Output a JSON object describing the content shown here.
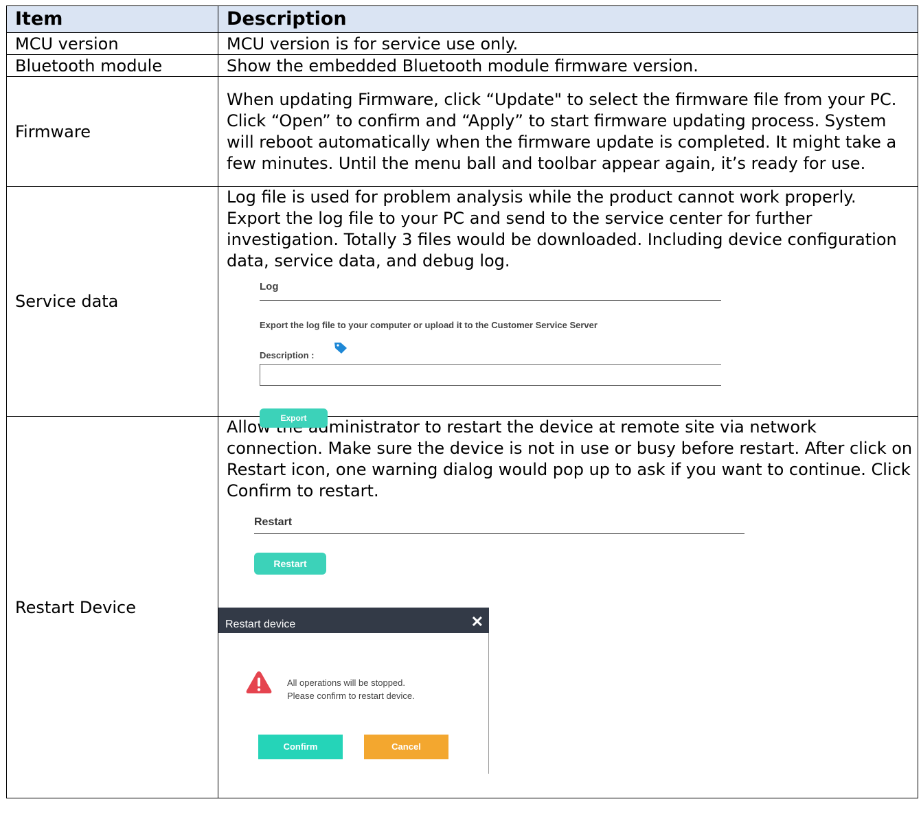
{
  "table": {
    "headers": {
      "item": "Item",
      "description": "Description"
    },
    "rows": [
      {
        "item": "MCU version",
        "description": "MCU version is for service use only."
      },
      {
        "item": "Bluetooth module",
        "description": "Show the embedded Bluetooth module firmware version."
      },
      {
        "item": "Firmware",
        "description": "When updating Firmware, click “Update\" to select the firmware file from your PC. Click “Open” to confirm and “Apply” to start firmware updating process. System will reboot automatically when the firmware update is completed. It might take a few minutes. Until the menu ball and toolbar appear again, it’s ready for use."
      },
      {
        "item": "Service data",
        "description": "Log file is used for problem analysis while the product cannot work properly. Export the log file to your PC and send to the service center for further investigation. Totally 3 files would be downloaded. Including device configuration data, service data, and debug log."
      },
      {
        "item": "Restart Device",
        "description": "Allow the administrator to restart the device at remote site via network connection. Make sure the device is not in use or busy before restart. After click on Restart icon, one warning dialog would pop up to ask if you want to continue. Click Confirm to restart."
      }
    ]
  },
  "log_panel": {
    "title": "Log",
    "text": "Export the log file to your computer or upload it to the Customer Service Server",
    "description_label": "Description :",
    "description_value": "",
    "export_label": "Export",
    "tag_icon": "tag-icon"
  },
  "restart_panel": {
    "title": "Restart",
    "restart_label": "Restart"
  },
  "dialog": {
    "title": "Restart device",
    "close_glyph": "✕",
    "message_line1": "All operations will be stopped.",
    "message_line2": "Please confirm to restart device.",
    "confirm_label": "Confirm",
    "cancel_label": "Cancel"
  },
  "colors": {
    "header_bg": "#dae4f3",
    "teal_button": "#3cd2b9",
    "confirm_button": "#25d4b8",
    "cancel_button": "#f3a72f",
    "dialog_header": "#333a47",
    "warning_red": "#e5444f",
    "tag_blue": "#1e88d6"
  }
}
